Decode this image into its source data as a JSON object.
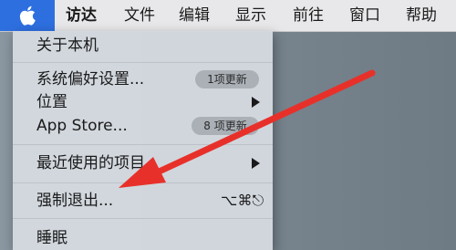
{
  "menubar": {
    "apple_icon": "apple-logo-icon",
    "accent_color": "#2e6fe0",
    "items": [
      "访达",
      "文件",
      "编辑",
      "显示",
      "前往",
      "窗口",
      "帮助"
    ]
  },
  "apple_menu": {
    "about": "关于本机",
    "system_prefs": "系统偏好设置...",
    "system_prefs_badge": "1项更新",
    "location": "位置",
    "app_store": "App Store...",
    "app_store_badge": "8 项更新",
    "recent_items": "最近使用的项目",
    "force_quit": "强制退出...",
    "force_quit_shortcut": "⌥⌘⎋",
    "sleep": "睡眠"
  },
  "annotation": {
    "arrow_color": "#e8302a",
    "arrow_icon": "red-arrow-icon"
  }
}
